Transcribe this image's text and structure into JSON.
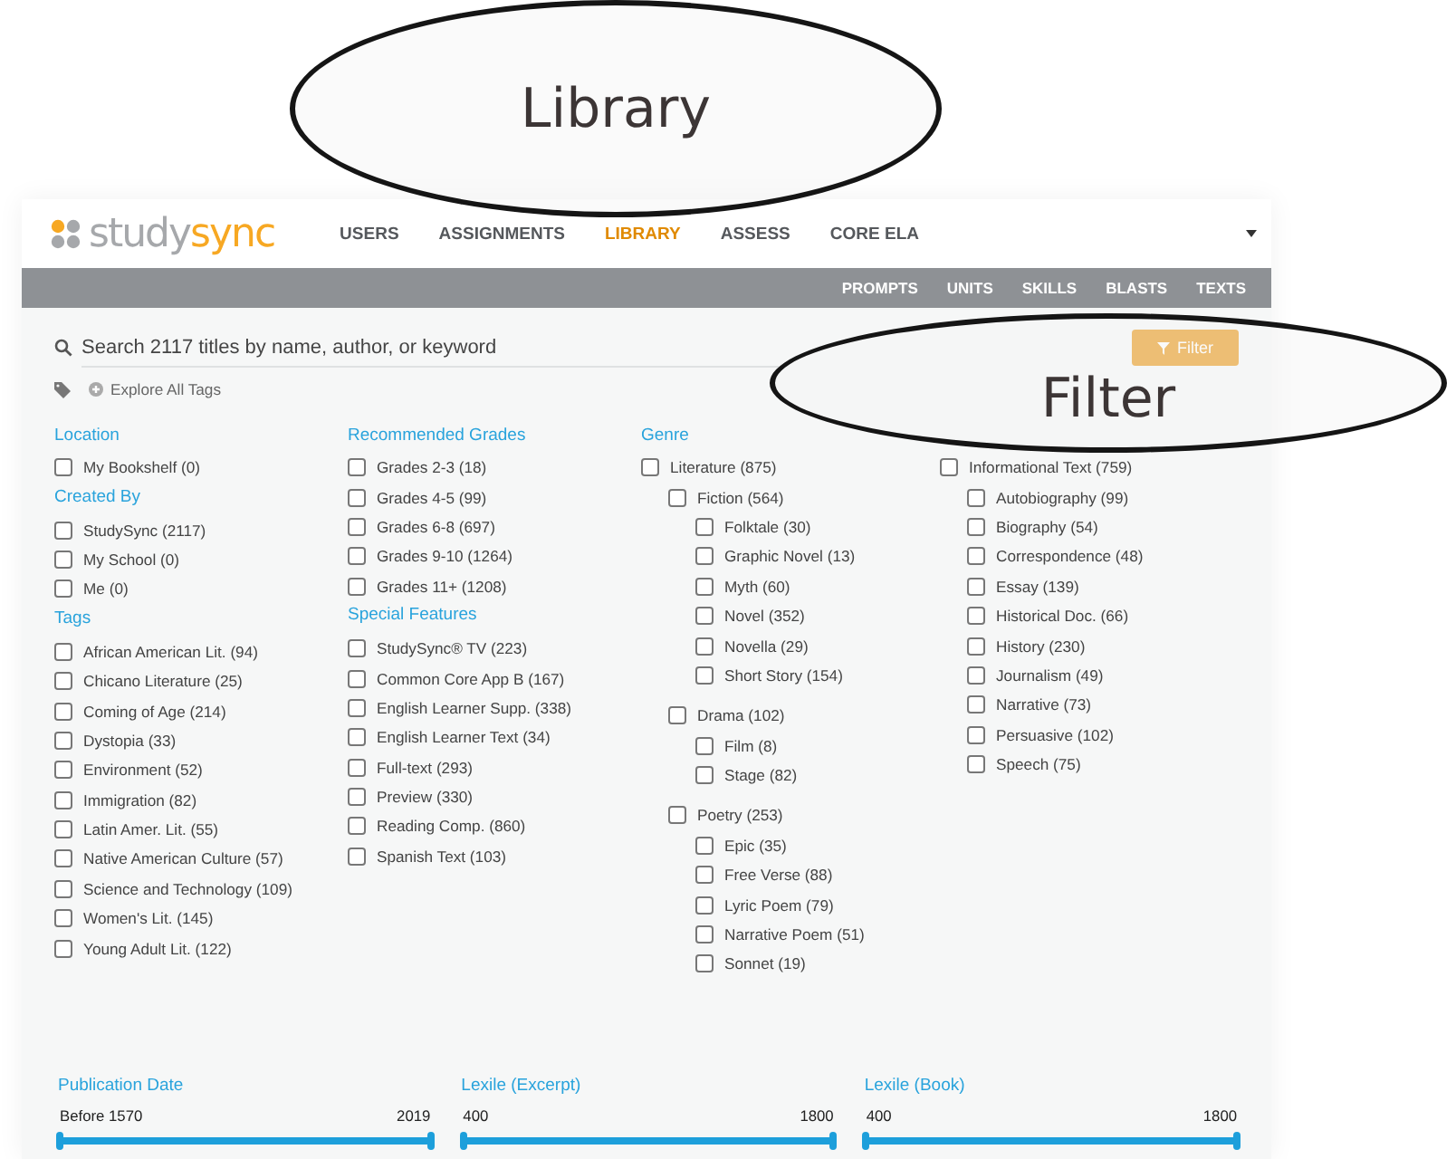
{
  "callouts": [
    {
      "text": "Library"
    },
    {
      "text": "Filter"
    }
  ],
  "header": {
    "logo": {
      "first": "study",
      "second": "sync"
    },
    "nav": [
      {
        "label": "USERS",
        "selected": false
      },
      {
        "label": "ASSIGNMENTS",
        "selected": false
      },
      {
        "label": "LIBRARY",
        "selected": true
      },
      {
        "label": "ASSESS",
        "selected": false
      },
      {
        "label": "CORE ELA",
        "selected": false
      }
    ],
    "subnav": [
      {
        "label": "PROMPTS",
        "selected": false
      },
      {
        "label": "UNITS",
        "selected": false
      },
      {
        "label": "SKILLS",
        "selected": false
      },
      {
        "label": "BLASTS",
        "selected": false
      },
      {
        "label": "TEXTS",
        "selected": false
      }
    ]
  },
  "search": {
    "placeholder": "Search 2117 titles by name, author, or keyword"
  },
  "explore_tags": "Explore All Tags",
  "filter_button": {
    "label": "Filter"
  },
  "columns": [
    [
      {
        "heading": "Location",
        "items": [
          {
            "label": "My Bookshelf (0)",
            "checked": false
          }
        ]
      },
      {
        "heading": "Created By",
        "items": [
          {
            "label": "StudySync (2117)",
            "checked": false
          },
          {
            "label": "My School (0)",
            "checked": false
          },
          {
            "label": "Me (0)",
            "checked": false
          }
        ]
      },
      {
        "heading": "Tags",
        "items": [
          {
            "label": "African American Lit. (94)",
            "checked": false
          },
          {
            "label": "Chicano Literature (25)",
            "checked": false
          },
          {
            "label": "Coming of Age (214)",
            "checked": false
          },
          {
            "label": "Dystopia (33)",
            "checked": false
          },
          {
            "label": "Environment (52)",
            "checked": false
          },
          {
            "label": "Immigration (82)",
            "checked": false
          },
          {
            "label": "Latin Amer. Lit. (55)",
            "checked": false
          },
          {
            "label": "Native American Culture (57)",
            "checked": false
          },
          {
            "label": "Science and Technology (109)",
            "checked": false
          },
          {
            "label": "Women's Lit. (145)",
            "checked": false
          },
          {
            "label": "Young Adult Lit. (122)",
            "checked": false
          }
        ]
      }
    ],
    [
      {
        "heading": "Recommended Grades",
        "items": [
          {
            "label": "Grades 2-3 (18)",
            "checked": false
          },
          {
            "label": "Grades 4-5 (99)",
            "checked": false
          },
          {
            "label": "Grades 6-8 (697)",
            "checked": false
          },
          {
            "label": "Grades 9-10 (1264)",
            "checked": false
          },
          {
            "label": "Grades 11+ (1208)",
            "checked": false
          }
        ]
      },
      {
        "heading": "Special Features",
        "items": [
          {
            "label": "StudySync® TV (223)",
            "checked": false
          },
          {
            "label": "Common Core App B (167)",
            "checked": false
          },
          {
            "label": "English Learner Supp. (338)",
            "checked": false
          },
          {
            "label": "English Learner Text (34)",
            "checked": false
          },
          {
            "label": "Full-text (293)",
            "checked": false
          },
          {
            "label": "Preview (330)",
            "checked": false
          },
          {
            "label": "Reading Comp. (860)",
            "checked": false
          },
          {
            "label": "Spanish Text (103)",
            "checked": false
          }
        ]
      }
    ],
    [
      {
        "heading": "Genre",
        "items": [
          {
            "label": "Literature (875)",
            "checked": false,
            "children": [
              {
                "label": "Fiction (564)",
                "checked": false,
                "children": [
                  {
                    "label": "Folktale (30)",
                    "checked": false
                  },
                  {
                    "label": "Graphic Novel (13)",
                    "checked": false
                  },
                  {
                    "label": "Myth (60)",
                    "checked": false
                  },
                  {
                    "label": "Novel (352)",
                    "checked": false
                  },
                  {
                    "label": "Novella (29)",
                    "checked": false
                  },
                  {
                    "label": "Short Story (154)",
                    "checked": false
                  }
                ]
              },
              {
                "label": "Drama (102)",
                "checked": false,
                "children": [
                  {
                    "label": "Film (8)",
                    "checked": false
                  },
                  {
                    "label": "Stage (82)",
                    "checked": false
                  }
                ]
              },
              {
                "label": "Poetry (253)",
                "checked": false,
                "children": [
                  {
                    "label": "Epic (35)",
                    "checked": false
                  },
                  {
                    "label": "Free Verse (88)",
                    "checked": false
                  },
                  {
                    "label": "Lyric Poem (79)",
                    "checked": false
                  },
                  {
                    "label": "Narrative Poem (51)",
                    "checked": false
                  },
                  {
                    "label": "Sonnet (19)",
                    "checked": false
                  }
                ]
              }
            ]
          },
          {
            "label": "Informational Text (759)",
            "checked": false,
            "children": [
              {
                "label": "Autobiography (99)",
                "checked": false
              },
              {
                "label": "Biography (54)",
                "checked": false
              },
              {
                "label": "Correspondence (48)",
                "checked": false
              },
              {
                "label": "Essay (139)",
                "checked": false
              },
              {
                "label": "Historical Doc. (66)",
                "checked": false
              },
              {
                "label": "History (230)",
                "checked": false
              },
              {
                "label": "Journalism (49)",
                "checked": false
              },
              {
                "label": "Narrative (73)",
                "checked": false
              },
              {
                "label": "Persuasive (102)",
                "checked": false
              },
              {
                "label": "Speech (75)",
                "checked": false
              }
            ]
          }
        ]
      }
    ]
  ],
  "sliders": [
    {
      "label": "Publication Date",
      "min": "Before 1570",
      "max": "2019",
      "level": 1
    },
    {
      "label": "Lexile (Excerpt)",
      "min": "400",
      "max": "1800",
      "level": 1
    },
    {
      "label": "Lexile (Book)",
      "min": "400",
      "max": "1800",
      "level": 1
    }
  ]
}
